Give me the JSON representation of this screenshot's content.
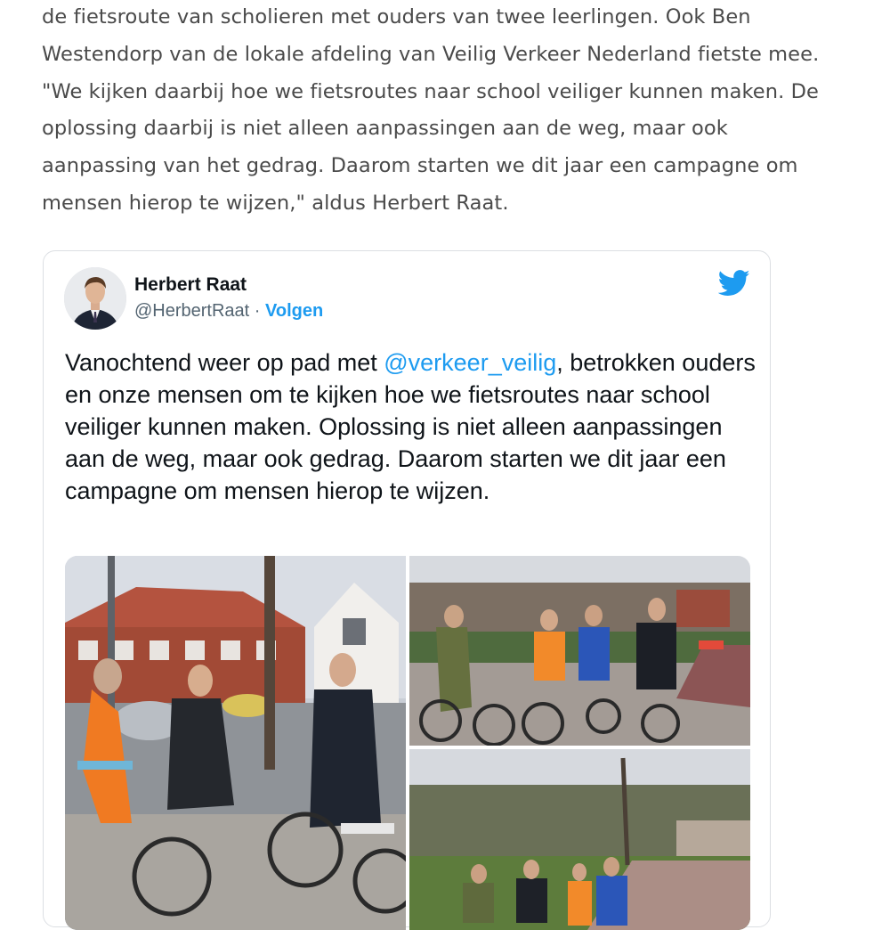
{
  "article": {
    "lines": [
      "de fietsroute van scholieren met ouders van twee leerlingen. Ook Ben",
      "Westendorp van de lokale afdeling van Veilig Verkeer Nederland fietste mee.",
      "\"We kijken daarbij hoe we fietsroutes naar school veiliger kunnen maken. De",
      "oplossing daarbij is niet alleen aanpassingen aan de weg, maar ook",
      "aanpassing van het gedrag. Daarom starten we dit jaar een campagne om",
      "mensen hierop te wijzen,\" aldus Herbert Raat."
    ]
  },
  "tweet": {
    "author_name": "Herbert Raat",
    "handle": "@HerbertRaat",
    "separator": " · ",
    "follow_label": "Volgen",
    "bird_icon": "twitter-bird-icon",
    "brand_color": "#1d9bf0",
    "text_before": "Vanochtend weer op pad met ",
    "mention": "@verkeer_veilig",
    "text_after": ", betrokken ouders en onze mensen om te kijken hoe we fietsroutes naar school veiliger kunnen maken. Oplossing is niet alleen aanpassingen aan de weg, maar ook gedrag. Daarom starten we dit jaar een campagne om mensen hierop te wijzen."
  }
}
